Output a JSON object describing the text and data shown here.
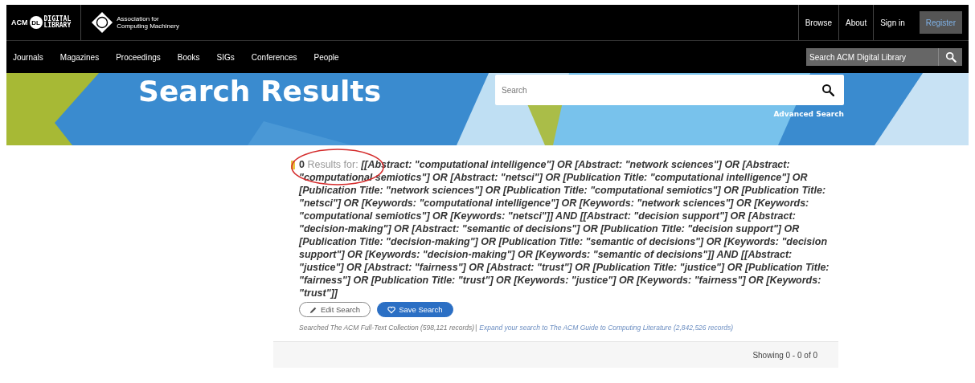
{
  "header": {
    "logo": {
      "acm": "ACM",
      "dl": "DL",
      "digital": "DIGITAL",
      "library": "LIBRARY"
    },
    "org_logo": {
      "line1": "Association for",
      "line2": "Computing Machinery"
    },
    "top_links": [
      {
        "label": "Browse",
        "kind": "link"
      },
      {
        "label": "About",
        "kind": "link"
      },
      {
        "label": "Sign in",
        "kind": "link"
      },
      {
        "label": "Register",
        "kind": "button"
      }
    ],
    "nav": [
      "Journals",
      "Magazines",
      "Proceedings",
      "Books",
      "SIGs",
      "Conferences",
      "People"
    ],
    "site_search": {
      "placeholder": "Search ACM Digital Library"
    }
  },
  "banner": {
    "title": "Search Results",
    "search": {
      "placeholder": "Search"
    },
    "advanced_link": "Advanced Search"
  },
  "results": {
    "count": "0",
    "label": "Results for:",
    "query": "[[Abstract: \"computational intelligence\"] OR [Abstract: \"network sciences\"] OR [Abstract: \"computational semiotics\"] OR [Abstract: \"netsci\"] OR [Publication Title: \"computational intelligence\"] OR [Publication Title: \"network sciences\"] OR [Publication Title: \"computational semiotics\"] OR [Publication Title: \"netsci\"] OR [Keywords: \"computational intelligence\"] OR [Keywords: \"network sciences\"] OR [Keywords: \"computational semiotics\"] OR [Keywords: \"netsci\"]] AND [[Abstract: \"decision support\"] OR [Abstract: \"decision-making\"] OR [Abstract: \"semantic of decisions\"] OR [Publication Title: \"decision support\"] OR [Publication Title: \"decision-making\"] OR [Publication Title: \"semantic of decisions\"] OR [Keywords: \"decision support\"] OR [Keywords: \"decision-making\"] OR [Keywords: \"semantic of decisions\"]] AND [[Abstract: \"justice\"] OR [Abstract: \"fairness\"] OR [Abstract: \"trust\"] OR [Publication Title: \"justice\"] OR [Publication Title: \"fairness\"] OR [Publication Title: \"trust\"] OR [Keywords: \"justice\"] OR [Keywords: \"fairness\"] OR [Keywords: \"trust\"]]",
    "buttons": [
      {
        "label": "Edit Search",
        "kind": "outline"
      },
      {
        "label": "Save Search",
        "kind": "primary"
      }
    ],
    "searched_note": "Searched The ACM Full-Text Collection (598,121 records)",
    "separator": "|",
    "expand_link": "Expand your search to The ACM Guide to Computing Literature (2,842,526 records)",
    "showing": "Showing 0 - 0 of 0"
  },
  "annotation": {
    "kind": "ellipse",
    "color": "#d42b2b"
  }
}
